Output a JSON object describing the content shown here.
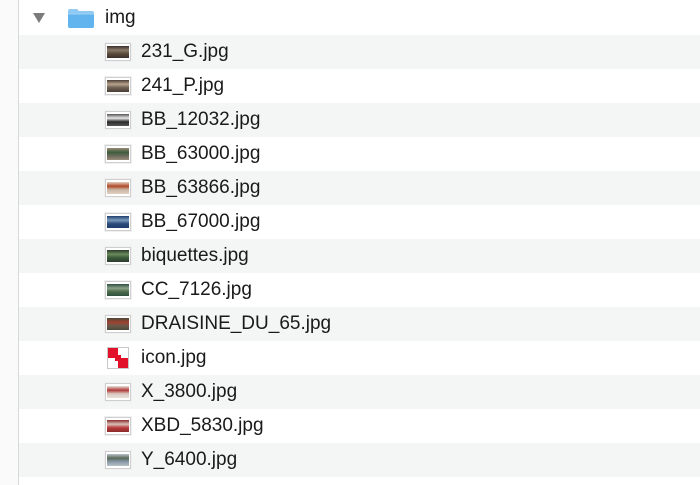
{
  "folder": {
    "name": "img",
    "expanded": true,
    "icon": "folder-icon",
    "color": "#5ab2ec"
  },
  "files": [
    {
      "name": "231_G.jpg",
      "thumb": [
        "#5a4a3a",
        "#8a7a6a",
        "#3b3029"
      ]
    },
    {
      "name": "241_P.jpg",
      "thumb": [
        "#6b5e52",
        "#b8a28c",
        "#4a3f35"
      ]
    },
    {
      "name": "BB_12032.jpg",
      "thumb": [
        "#2b2b2b",
        "#e8e8e8",
        "#555555"
      ]
    },
    {
      "name": "BB_63000.jpg",
      "thumb": [
        "#6a6a5a",
        "#3e5e3a",
        "#9a8b7a"
      ]
    },
    {
      "name": "BB_63866.jpg",
      "thumb": [
        "#c9b7a6",
        "#b24a2a",
        "#e0d0c0"
      ]
    },
    {
      "name": "BB_67000.jpg",
      "thumb": [
        "#2a4a7a",
        "#7a9aba",
        "#1e3e6e"
      ]
    },
    {
      "name": "biquettes.jpg",
      "thumb": [
        "#3a5a3a",
        "#6a8a5a",
        "#2a3a2a"
      ]
    },
    {
      "name": "CC_7126.jpg",
      "thumb": [
        "#4a6a4a",
        "#8aa08a",
        "#2f4f3f"
      ]
    },
    {
      "name": "DRAISINE_DU_65.jpg",
      "thumb": [
        "#6a5a4a",
        "#a04030",
        "#4a4a3a"
      ]
    },
    {
      "name": "icon.jpg",
      "thumb": "checker"
    },
    {
      "name": "X_3800.jpg",
      "thumb": [
        "#d8c8c0",
        "#b03a3a",
        "#e8e0d8"
      ]
    },
    {
      "name": "XBD_5830.jpg",
      "thumb": [
        "#b83a3a",
        "#d8c0b8",
        "#8a2a2a"
      ]
    },
    {
      "name": "Y_6400.jpg",
      "thumb": [
        "#8a9aa8",
        "#5a6a5a",
        "#b8c0c8"
      ]
    }
  ]
}
